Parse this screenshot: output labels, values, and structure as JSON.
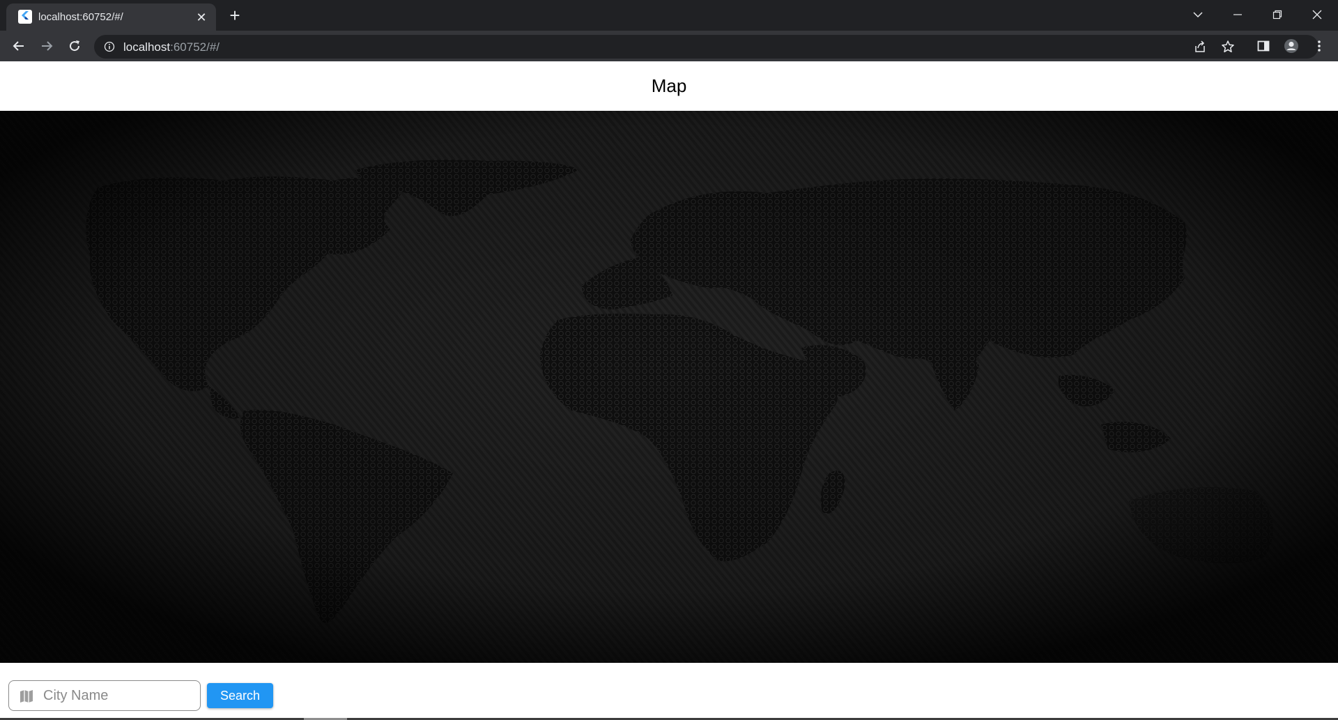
{
  "browser": {
    "tab_title": "localhost:60752/#/",
    "close_glyph": "✕",
    "new_tab_glyph": "+",
    "url_host": "localhost",
    "url_rest": ":60752/#/",
    "icons": [
      "flutter-favicon",
      "back-arrow-icon",
      "forward-arrow-icon",
      "reload-icon",
      "info-icon",
      "share-icon",
      "star-icon",
      "side-panel-icon",
      "profile-icon",
      "kebab-menu-icon",
      "tab-search-icon",
      "minimize-icon",
      "restore-icon",
      "close-window-icon"
    ]
  },
  "app": {
    "title": "Map",
    "map_background": "world-map-dark-carbon",
    "search": {
      "placeholder": "City Name",
      "value": "",
      "button_label": "Search",
      "icon": "map-icon"
    }
  },
  "colors": {
    "chrome_dark": "#202124",
    "chrome_tab": "#35363a",
    "map_bg": "#141414",
    "accent": "#2196f3"
  }
}
